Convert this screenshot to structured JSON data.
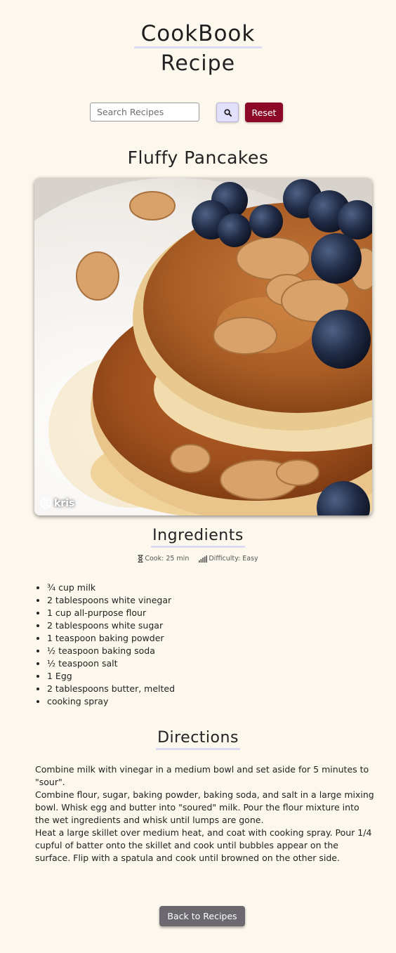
{
  "header": {
    "title": "CookBook",
    "subtitle": "Recipe"
  },
  "search": {
    "placeholder": "Search Recipes",
    "value": "",
    "reset_label": "Reset"
  },
  "recipe": {
    "title": "Fluffy Pancakes",
    "image_author": "kris",
    "ingredients_heading": "Ingredients",
    "cook_time": "Cook: 25 min",
    "difficulty": "Difficulty: Easy",
    "ingredients": [
      "¾ cup milk",
      "2 tablespoons white vinegar",
      "1 cup all-purpose flour",
      "2 tablespoons white sugar",
      "1 teaspoon baking powder",
      "½ teaspoon baking soda",
      "½ teaspoon salt",
      "1 Egg",
      "2 tablespoons butter, melted",
      "cooking spray"
    ],
    "directions_heading": "Directions",
    "directions": [
      "Combine milk with vinegar in a medium bowl and set aside for 5 minutes to \"sour\".",
      "Combine flour, sugar, baking powder, baking soda, and salt in a large mixing bowl. Whisk egg and butter into \"soured\" milk. Pour the flour mixture into the wet ingredients and whisk until lumps are gone.",
      "Heat a large skillet over medium heat, and coat with cooking spray. Pour 1/4 cupful of batter onto the skillet and cook until bubbles appear on the surface. Flip with a spatula and cook until browned on the other side."
    ]
  },
  "footer": {
    "back_label": "Back to Recipes"
  },
  "colors": {
    "background": "#fdf8ee",
    "accent_underline": "#dcd9f3",
    "reset": "#8c0a25",
    "back": "#6b6870"
  },
  "icons": {
    "search": "search-icon",
    "author": "user-circle-icon",
    "cook": "hourglass-icon",
    "difficulty": "signal-bars-icon"
  }
}
